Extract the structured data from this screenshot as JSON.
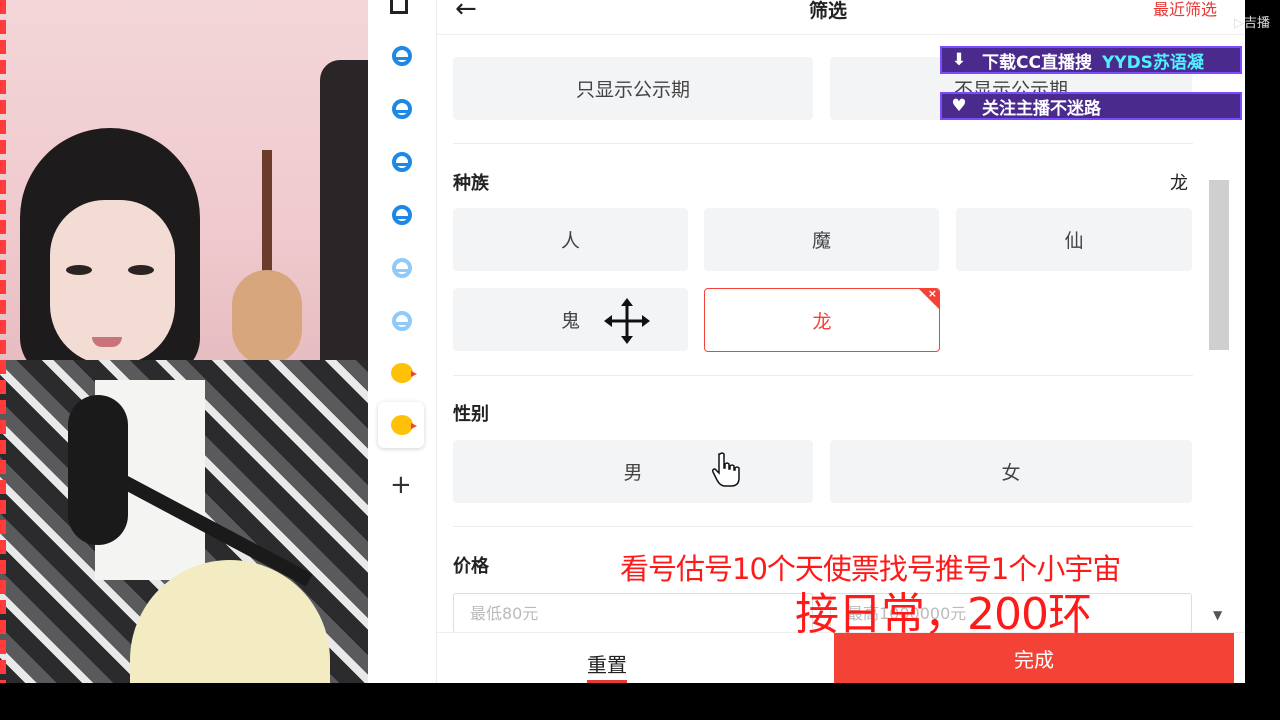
{
  "panel": {
    "title": "筛选",
    "recent": "最近筛选",
    "publicity": {
      "show_only": "只显示公示期",
      "hide": "不显示公示期"
    },
    "race": {
      "label": "种族",
      "selected": "龙",
      "options": [
        "人",
        "魔",
        "仙",
        "鬼",
        "龙"
      ]
    },
    "gender": {
      "label": "性别",
      "options": [
        "男",
        "女"
      ]
    },
    "price": {
      "label": "价格",
      "min_placeholder": "最低80元",
      "max_placeholder": "最高1000000元"
    },
    "footer": {
      "reset": "重置",
      "done": "完成"
    }
  },
  "overlay": {
    "banner1": {
      "text": "下载CC直播搜",
      "highlight": "YYDS苏语凝"
    },
    "banner2": {
      "text": "关注主播不迷路"
    },
    "corner": "▷吉播",
    "caption1": "看号估号10个天使票找号推号1个小宇宙",
    "caption2": "接日常，200环"
  },
  "colors": {
    "accent_red": "#f44336",
    "banner_purple": "#4a2a8c",
    "banner_highlight": "#4df3ff"
  }
}
